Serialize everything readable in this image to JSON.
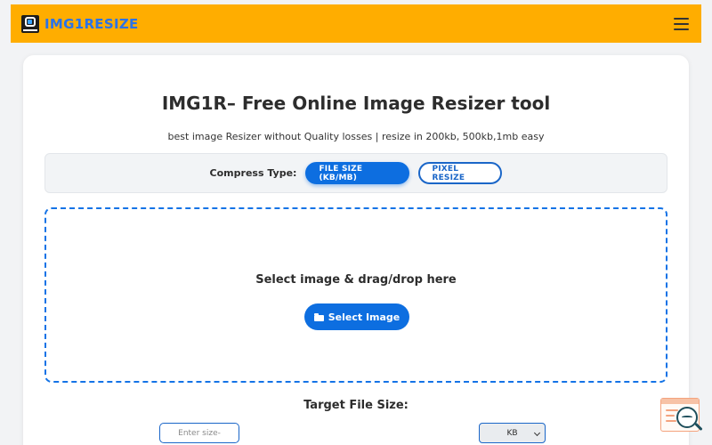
{
  "navbar": {
    "brand_name": "IMG1RESIZE",
    "brand_color": "#2a73e8",
    "background_color": "#ffad00",
    "logo_icon": "img1resize-logo",
    "menu_icon": "hamburger-icon"
  },
  "main": {
    "title": "IMG1R– Free Online Image Resizer tool",
    "subtitle": "best image Resizer without Quality losses | resize in 200kb, 500kb,1mb easy",
    "compress": {
      "label": "Compress Type:",
      "options": [
        {
          "label": "FILE SIZE (KB/MB)",
          "active": true
        },
        {
          "label": "PIXEL RESIZE",
          "active": false
        }
      ]
    },
    "dropzone": {
      "text": "Select image & drag/drop here",
      "button_label": "Select Image",
      "button_icon": "folder-open-icon",
      "border_color": "#1473e6"
    },
    "target": {
      "label": "Target File Size:",
      "input_placeholder": "Enter size-",
      "input_value": "",
      "unit_selected": "KB"
    }
  },
  "floating_widget": {
    "icon": "document-search-icon"
  }
}
